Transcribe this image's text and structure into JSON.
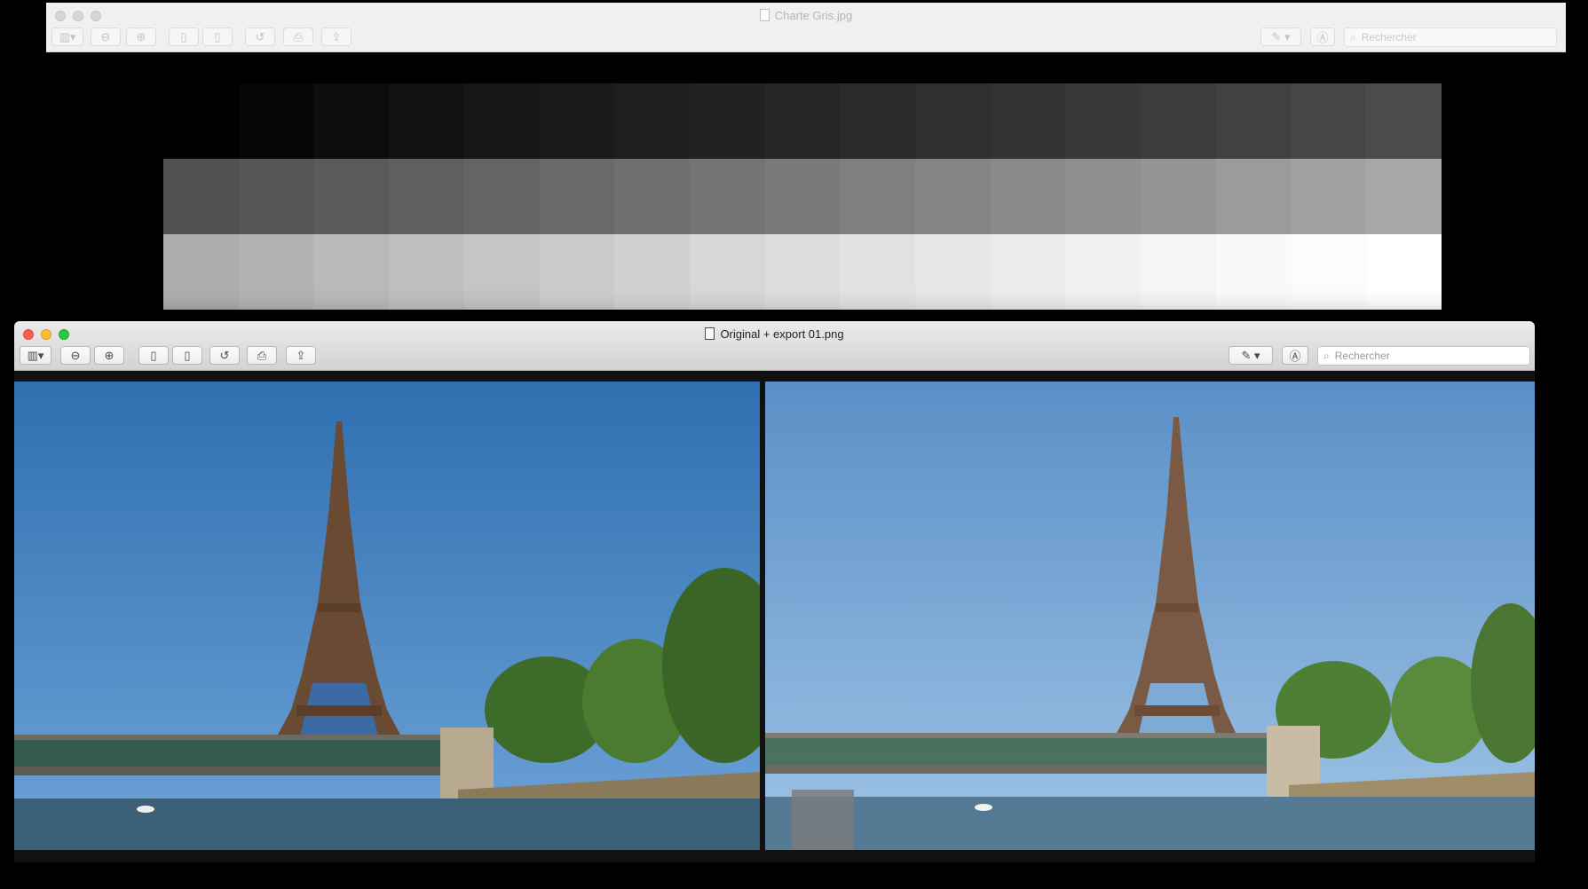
{
  "back_window": {
    "title": "Charte Gris.jpg",
    "search_placeholder": "Rechercher",
    "gray_rows": [
      [
        "#000000",
        "#060606",
        "#0d0d0d",
        "#111111",
        "#161616",
        "#1a1a1a",
        "#1e1e1e",
        "#222222",
        "#262626",
        "#2b2b2b",
        "#2f2f2f",
        "#333333",
        "#383838",
        "#3c3c3c",
        "#414141",
        "#464646",
        "#4b4b4b"
      ],
      [
        "#505050",
        "#555555",
        "#5a5a5a",
        "#5f5f5f",
        "#646464",
        "#696969",
        "#6f6f6f",
        "#747474",
        "#797979",
        "#7f7f7f",
        "#848484",
        "#8a8a8a",
        "#8f8f8f",
        "#959595",
        "#9b9b9b",
        "#a1a1a1",
        "#a7a7a7"
      ],
      [
        "#adadad",
        "#b3b3b3",
        "#b9b9b9",
        "#bfbfbf",
        "#c5c5c5",
        "#cbcbcb",
        "#d1d1d1",
        "#d7d7d7",
        "#dddddd",
        "#e2e2e2",
        "#e7e7e7",
        "#ececec",
        "#f1f1f1",
        "#f5f5f5",
        "#f9f9f9",
        "#fcfcfc",
        "#ffffff"
      ]
    ]
  },
  "front_window": {
    "title": "Original + export 01.png",
    "search_placeholder": "Rechercher"
  },
  "toolbar_icons": [
    "sidebar-icon",
    "zoom-out-icon",
    "zoom-in-icon",
    "previous-page-icon",
    "next-page-icon",
    "rotate-icon",
    "print-icon",
    "share-icon",
    "markup-icon",
    "annotate-icon",
    "search-icon"
  ]
}
